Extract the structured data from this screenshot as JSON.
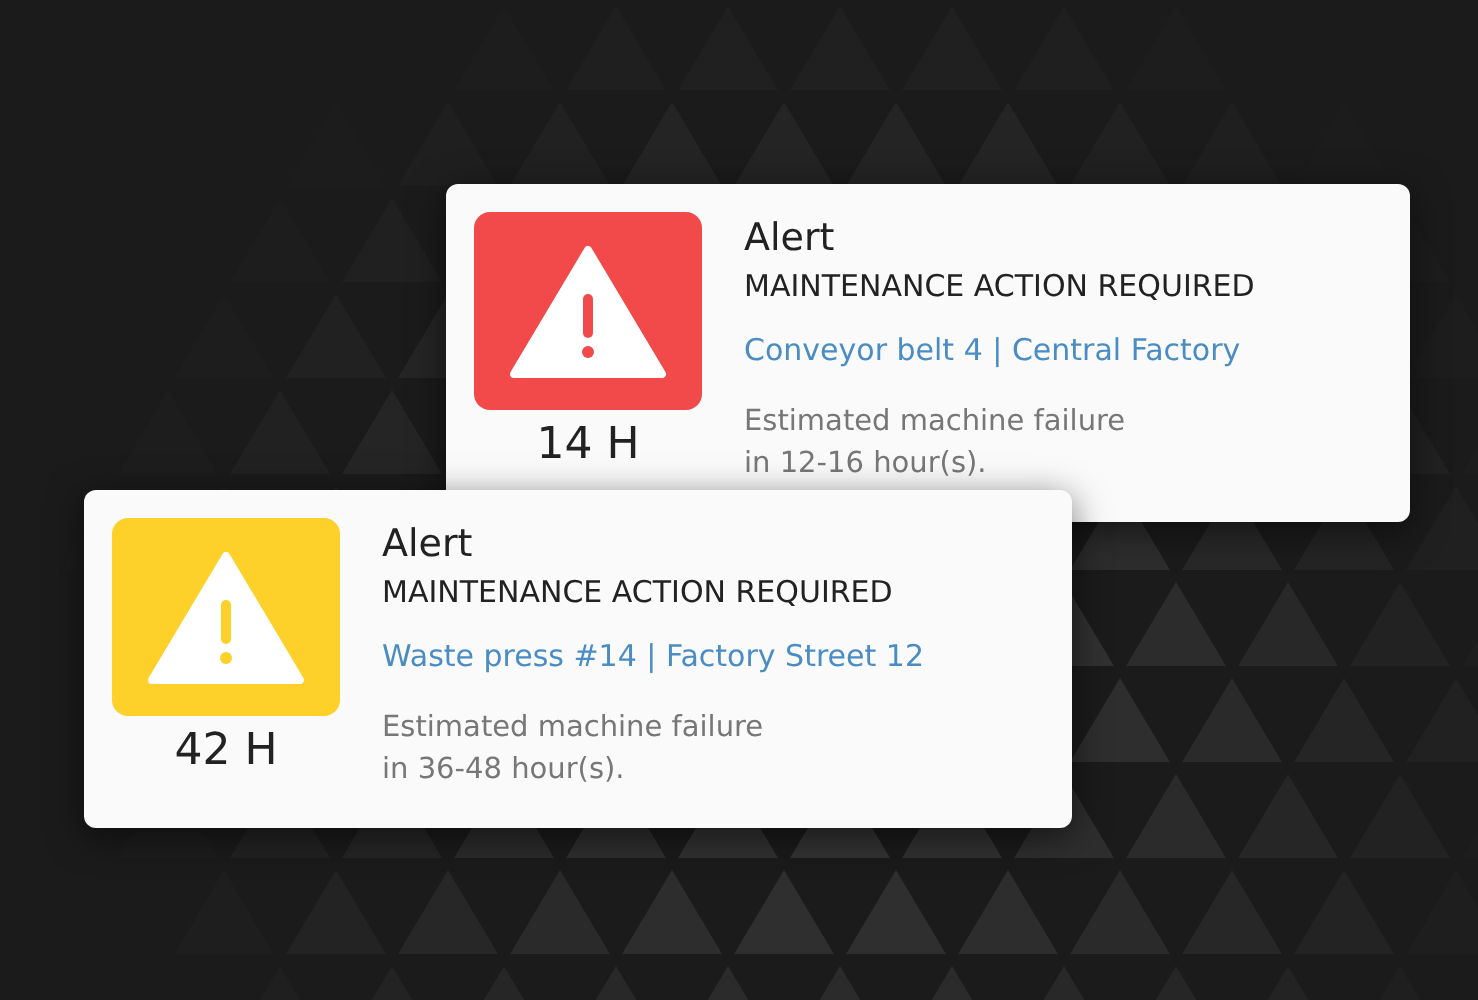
{
  "alerts": [
    {
      "title": "Alert",
      "subtitle": "MAINTENANCE ACTION REQUIRED",
      "location": "Conveyor belt 4 | Central Factory",
      "message": [
        "Estimated machine failure",
        "in 12-16 hour(s)."
      ],
      "hours": "14 H",
      "color": "#f24a4a"
    },
    {
      "title": "Alert",
      "subtitle": "MAINTENANCE ACTION REQUIRED",
      "location": "Waste press #14 | Factory Street 12",
      "message": [
        "Estimated machine failure",
        "in 36-48 hour(s)."
      ],
      "hours": "42 H",
      "color": "#fdd02a"
    }
  ]
}
